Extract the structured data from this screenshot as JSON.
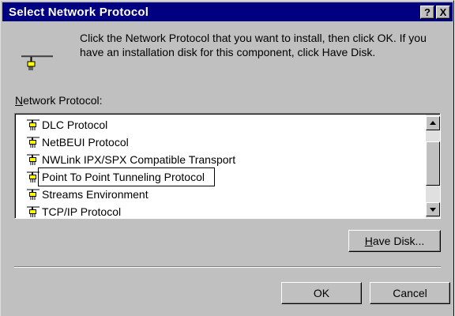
{
  "dialog": {
    "title": "Select Network Protocol",
    "help_button": "?",
    "close_button": "X",
    "intro": "Click the Network Protocol that you want to install, then click OK.  If you have an installation disk for this component, click Have Disk."
  },
  "protocol_list": {
    "label_first": "N",
    "label_rest": "etwork Protocol:",
    "items": [
      {
        "label": "DLC Protocol"
      },
      {
        "label": "NetBEUI Protocol"
      },
      {
        "label": "NWLink IPX/SPX Compatible Transport"
      },
      {
        "label": "Point To Point Tunneling Protocol"
      },
      {
        "label": "Streams Environment"
      },
      {
        "label": "TCP/IP Protocol"
      }
    ],
    "selected_index": 3
  },
  "buttons": {
    "have_disk_first": "H",
    "have_disk_rest": "ave Disk...",
    "ok": "OK",
    "cancel": "Cancel"
  },
  "colors": {
    "titlebar": "#000080",
    "face": "#c0c0c0",
    "icon_yellow": "#ffff00"
  },
  "icons": {
    "header": "network-cable-icon",
    "item": "network-protocol-icon"
  }
}
